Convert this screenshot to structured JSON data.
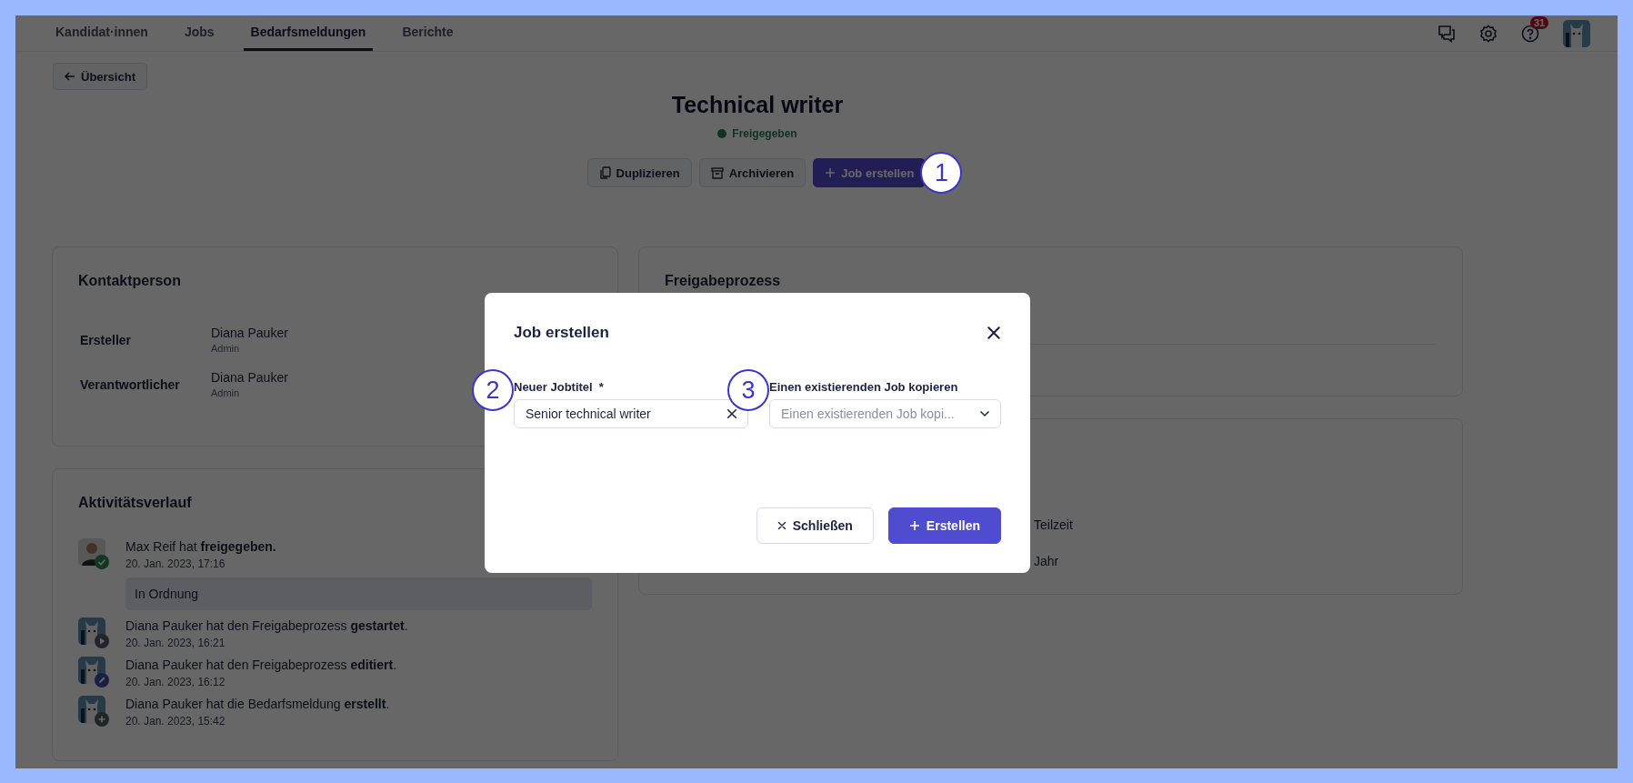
{
  "nav": {
    "tabs": [
      {
        "label": "Kandidat·innen",
        "selected": false
      },
      {
        "label": "Jobs",
        "selected": false
      },
      {
        "label": "Bedarfsmeldungen",
        "selected": true
      },
      {
        "label": "Berichte",
        "selected": false
      }
    ],
    "notification_count": "31"
  },
  "back_button": "Übersicht",
  "title": "Technical writer",
  "status": "Freigegeben",
  "actions": [
    {
      "kind": "copy",
      "label": "Duplizieren"
    },
    {
      "kind": "archive",
      "label": "Archivieren"
    },
    {
      "kind": "create",
      "label": "Job erstellen",
      "marker": "1"
    }
  ],
  "contact_card": {
    "title": "Kontaktperson",
    "rows": [
      {
        "role": "Ersteller",
        "name": "Diana Pauker",
        "position": "Admin"
      },
      {
        "role": "Verantwortlicher",
        "name": "Diana Pauker",
        "position": "Admin"
      }
    ]
  },
  "activity_card": {
    "title": "Aktivitätsverlauf",
    "items": [
      {
        "kind": "approved",
        "text": "Max Reif hat **freigegeben.**",
        "time": "20. Jan. 2023, 17:16",
        "comment": "In Ordnung"
      },
      {
        "kind": "started",
        "text": "Diana Pauker hat den Freigabeprozess **gestartet**.",
        "time": "20. Jan. 2023, 16:21"
      },
      {
        "kind": "edited",
        "text": "Diana Pauker hat den Freigabeprozess **editiert**.",
        "time": "20. Jan. 2023, 16:12"
      },
      {
        "kind": "created",
        "text": "Diana Pauker hat die Bedarfsmeldung **erstellt**.",
        "time": "20. Jan. 2023, 15:42"
      }
    ]
  },
  "approval_card": {
    "title": "Freigabeprozess"
  },
  "details_card": {
    "values": [
      "Teilzeit",
      "Jahr"
    ]
  },
  "dialog": {
    "title": "Job erstellen",
    "fields": [
      {
        "kind": "text",
        "label": "Neuer Jobtitel",
        "required_mark": "*",
        "value": "Senior technical writer",
        "marker": "2"
      },
      {
        "kind": "select",
        "label": "Einen existierenden Job kopieren",
        "placeholder": "Einen existierenden Job kopi...",
        "marker": "3"
      }
    ],
    "buttons": [
      {
        "kind": "secondary",
        "label": "Schließen"
      },
      {
        "kind": "primary",
        "label": "Erstellen"
      }
    ]
  }
}
